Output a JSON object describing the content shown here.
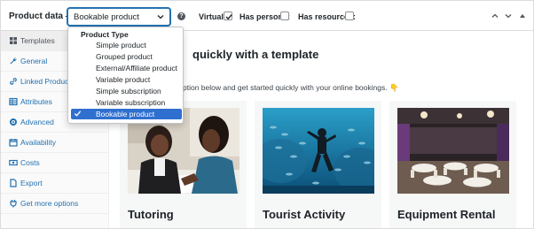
{
  "header": {
    "title": "Product data —",
    "product_type_value": "Bookable product",
    "options": [
      {
        "label": "Virtual:",
        "checked": true
      },
      {
        "label": "Has persons:",
        "checked": false
      },
      {
        "label": "Has resources:",
        "checked": false
      }
    ]
  },
  "product_type_dropdown": {
    "group_label": "Product Type",
    "items": [
      {
        "label": "Simple product",
        "selected": false
      },
      {
        "label": "Grouped product",
        "selected": false
      },
      {
        "label": "External/Affiliate product",
        "selected": false
      },
      {
        "label": "Variable product",
        "selected": false
      },
      {
        "label": "Simple subscription",
        "selected": false
      },
      {
        "label": "Variable subscription",
        "selected": false
      },
      {
        "label": "Bookable product",
        "selected": true
      }
    ]
  },
  "sidebar": {
    "tabs": [
      {
        "label": "Templates",
        "icon": "grid-icon",
        "active": true
      },
      {
        "label": "General",
        "icon": "wrench-icon",
        "active": false
      },
      {
        "label": "Linked Products",
        "icon": "link-icon",
        "active": false
      },
      {
        "label": "Attributes",
        "icon": "table-icon",
        "active": false
      },
      {
        "label": "Advanced",
        "icon": "gear-icon",
        "active": false
      },
      {
        "label": "Availability",
        "icon": "calendar-icon",
        "active": false
      },
      {
        "label": "Costs",
        "icon": "money-icon",
        "active": false
      },
      {
        "label": "Export",
        "icon": "document-icon",
        "active": false
      },
      {
        "label": "Get more options",
        "icon": "plug-icon",
        "active": false
      }
    ]
  },
  "main": {
    "heading": "quickly with a template",
    "intro": "ption below and get started quickly with your online bookings. 👇",
    "cards": [
      {
        "title": "Tutoring",
        "image": "tutoring-photo"
      },
      {
        "title": "Tourist Activity",
        "image": "scuba-diving-photo"
      },
      {
        "title": "Equipment Rental",
        "image": "event-hall-photo"
      }
    ]
  },
  "colors": {
    "accent": "#2271b1",
    "selected_option": "#2f6fd0",
    "card_background": "#f6f7f7"
  }
}
